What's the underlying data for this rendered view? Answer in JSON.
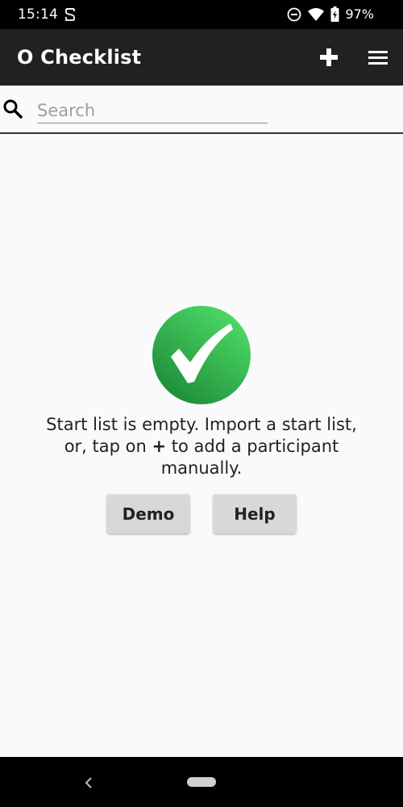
{
  "status_bar": {
    "time": "15:14",
    "battery": "97%",
    "icons": [
      "notification-icon",
      "dnd-icon",
      "wifi-icon",
      "battery-icon"
    ]
  },
  "app_bar": {
    "title": "O Checklist",
    "icons": [
      "add-icon",
      "menu-icon"
    ]
  },
  "search": {
    "placeholder": "Search",
    "value": ""
  },
  "empty_state": {
    "icon": "check-circle-icon",
    "message_before": "Start list is empty. Import a start list, or, tap on ",
    "message_plus": "+",
    "message_after": " to add a participant manually.",
    "demo_label": "Demo",
    "help_label": "Help"
  },
  "colors": {
    "app_bar": "#212121",
    "background": "#faf9fb",
    "check_green_light": "#4cd964",
    "check_green_dark": "#1e8c3a",
    "button": "#d8d8d8"
  }
}
